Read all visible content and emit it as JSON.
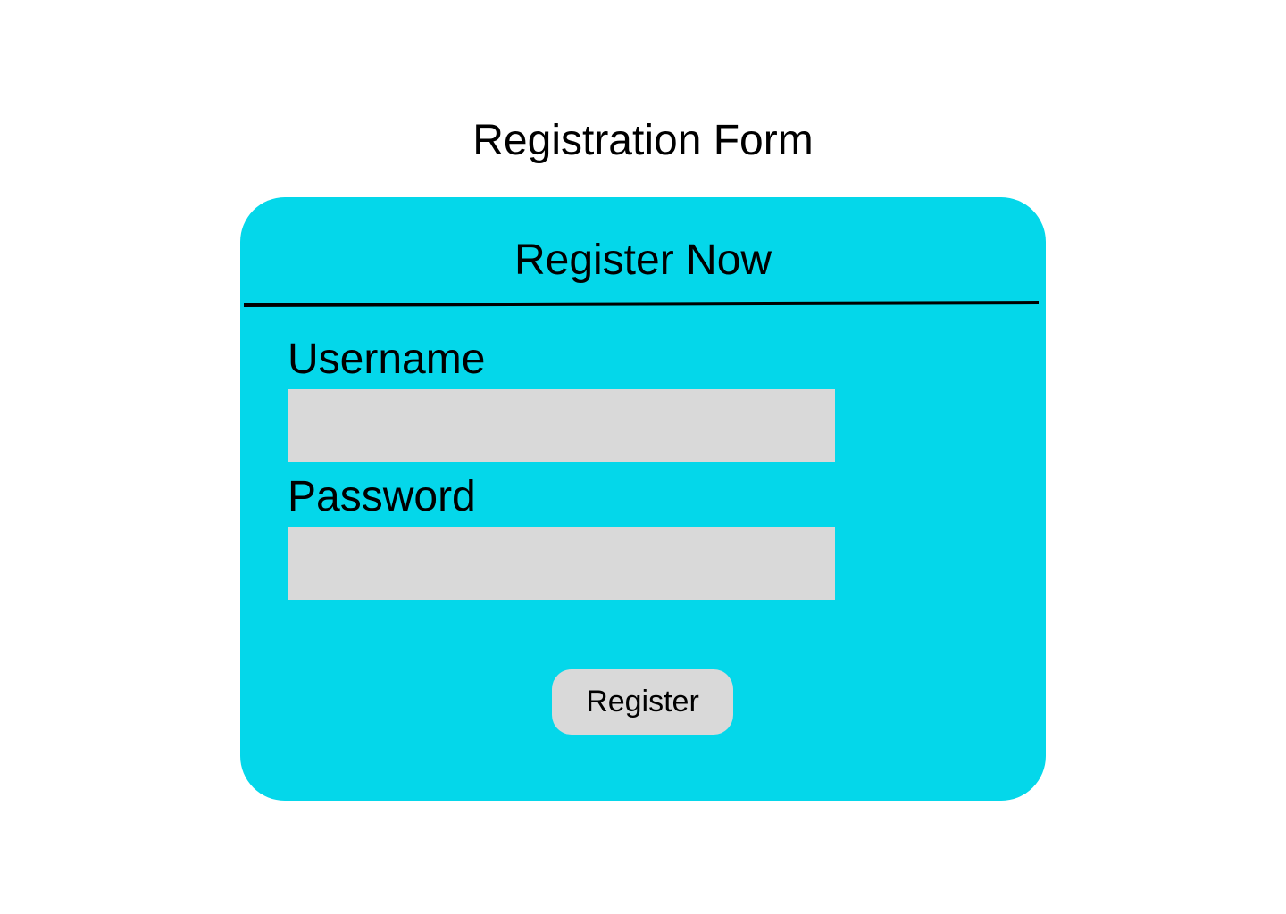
{
  "page": {
    "title": "Registration Form"
  },
  "form": {
    "header": "Register Now",
    "username": {
      "label": "Username",
      "value": "",
      "placeholder": ""
    },
    "password": {
      "label": "Password",
      "value": "",
      "placeholder": ""
    },
    "submit_label": "Register"
  },
  "colors": {
    "card_background": "#04d7ea",
    "input_background": "#d9d9d9",
    "button_background": "#d9d9d9",
    "text": "#000000",
    "page_background": "#ffffff"
  }
}
